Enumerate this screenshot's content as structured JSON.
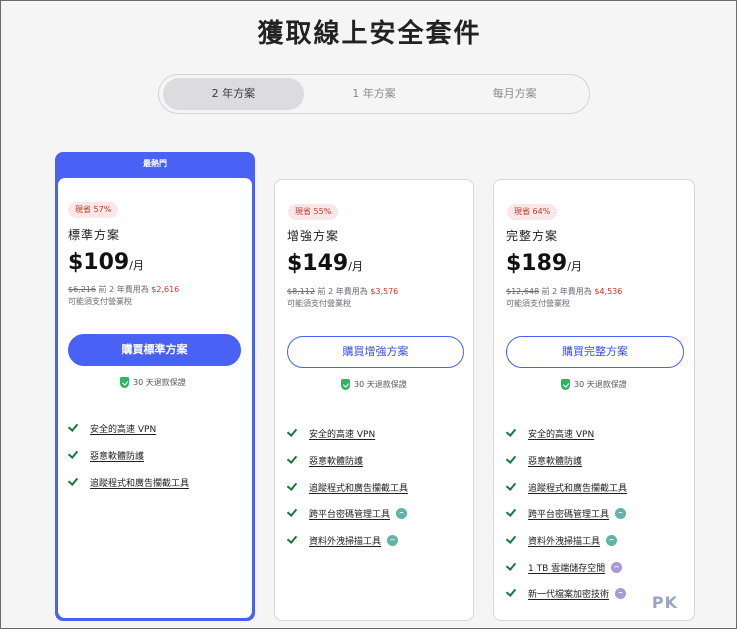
{
  "header": {
    "title": "獲取線上安全套件"
  },
  "billing_toggle": {
    "tabs": [
      {
        "label": "2 年方案",
        "active": true
      },
      {
        "label": "1 年方案",
        "active": false
      },
      {
        "label": "每月方案",
        "active": false
      }
    ]
  },
  "plans": [
    {
      "banner": "最熱門",
      "badge": "現省 57%",
      "name": "標準方案",
      "price": "$109",
      "unit": "/月",
      "old_price": "$6,216",
      "renew_text": " 前 2 年費用為 ",
      "new_price": "$2,616",
      "tax_note": "可能須支付營業稅",
      "buy_label": "購買標準方案",
      "guarantee": "30 天退款保證",
      "features": [
        {
          "label": "安全的高速 VPN"
        },
        {
          "label": "惡意軟體防護"
        },
        {
          "label": "追蹤程式和廣告攔截工具"
        }
      ]
    },
    {
      "badge": "現省 55%",
      "name": "增強方案",
      "price": "$149",
      "unit": "/月",
      "old_price": "$8,112",
      "renew_text": " 前 2 年費用為 ",
      "new_price": "$3,576",
      "tax_note": "可能須支付營業稅",
      "buy_label": "購買增強方案",
      "guarantee": "30 天退款保證",
      "features": [
        {
          "label": "安全的高速 VPN"
        },
        {
          "label": "惡意軟體防護"
        },
        {
          "label": "追蹤程式和廣告攔截工具"
        },
        {
          "label": "跨平台密碼管理工具",
          "icon": "teal-icon"
        },
        {
          "label": "資料外洩掃描工具",
          "icon": "teal-icon"
        }
      ]
    },
    {
      "badge": "現省 64%",
      "name": "完整方案",
      "price": "$189",
      "unit": "/月",
      "old_price": "$12,648",
      "renew_text": " 前 2 年費用為 ",
      "new_price": "$4,536",
      "tax_note": "可能須支付營業稅",
      "buy_label": "購買完整方案",
      "guarantee": "30 天退款保證",
      "features": [
        {
          "label": "安全的高速 VPN"
        },
        {
          "label": "惡意軟體防護"
        },
        {
          "label": "追蹤程式和廣告攔截工具"
        },
        {
          "label": "跨平台密碼管理工具",
          "icon": "teal-icon"
        },
        {
          "label": "資料外洩掃描工具",
          "icon": "teal-icon"
        },
        {
          "label": "1 TB 雲端儲存空間",
          "icon": "purple-icon"
        },
        {
          "label": "新一代檔案加密技術",
          "icon": "purple-icon"
        }
      ]
    }
  ],
  "watermark": "PK",
  "colors": {
    "accent": "#4a61f5",
    "discount": "#d2332a",
    "check": "#157a3a"
  }
}
